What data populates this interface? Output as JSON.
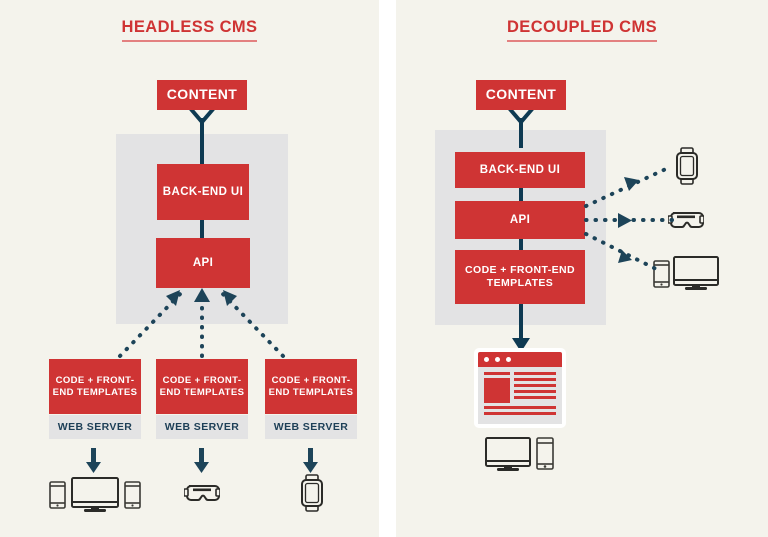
{
  "theme": {
    "background": "#f4f3ec",
    "accent_red": "#cf3434",
    "navy": "#0e3a52",
    "gray_panel": "#e3e3e4",
    "page_white": "#ffffff"
  },
  "panels": [
    {
      "id": "headless",
      "title": "HEADLESS CMS",
      "content_box": "CONTENT",
      "backend_box": "BACK-END UI",
      "api_box": "API",
      "server_columns": [
        {
          "code_label": "CODE + FRONT-END TEMPLATES",
          "server_label": "WEB SERVER",
          "device_group": "phone-monitor-tablet"
        },
        {
          "code_label": "CODE + FRONT-END TEMPLATES",
          "server_label": "WEB SERVER",
          "device_group": "vr-headset"
        },
        {
          "code_label": "CODE + FRONT-END TEMPLATES",
          "server_label": "WEB SERVER",
          "device_group": "smartwatch"
        }
      ]
    },
    {
      "id": "decoupled",
      "title": "DECOUPLED CMS",
      "content_box": "CONTENT",
      "backend_box": "BACK-END UI",
      "api_box": "API",
      "code_box": "CODE + FRONT-END TEMPLATES",
      "api_consumers": [
        "smartwatch",
        "vr-headset",
        "tablet-monitor"
      ],
      "output_devices": [
        "monitor",
        "phone"
      ]
    }
  ],
  "chart_data": {
    "type": "diagram",
    "title": "Headless CMS vs Decoupled CMS",
    "nodes": [
      {
        "panel": "headless",
        "label": "CONTENT",
        "kind": "red-box"
      },
      {
        "panel": "headless",
        "label": "BACK-END UI",
        "kind": "red-box",
        "inside": "cms-gray-region"
      },
      {
        "panel": "headless",
        "label": "API",
        "kind": "red-box",
        "inside": "cms-gray-region"
      },
      {
        "panel": "headless",
        "label": "CODE + FRONT-END TEMPLATES",
        "kind": "red-box",
        "instances": 3
      },
      {
        "panel": "headless",
        "label": "WEB SERVER",
        "kind": "gray-box",
        "instances": 3
      },
      {
        "panel": "decoupled",
        "label": "CONTENT",
        "kind": "red-box"
      },
      {
        "panel": "decoupled",
        "label": "BACK-END UI",
        "kind": "red-box",
        "inside": "cms-gray-region"
      },
      {
        "panel": "decoupled",
        "label": "API",
        "kind": "red-box",
        "inside": "cms-gray-region"
      },
      {
        "panel": "decoupled",
        "label": "CODE + FRONT-END TEMPLATES",
        "kind": "red-box",
        "inside": "cms-gray-region"
      }
    ],
    "edges": [
      {
        "panel": "headless",
        "from": "CONTENT",
        "to": "BACK-END UI",
        "style": "solid"
      },
      {
        "panel": "headless",
        "from": "BACK-END UI",
        "to": "API",
        "style": "solid"
      },
      {
        "panel": "headless",
        "from": "CODE + FRONT-END TEMPLATES",
        "to": "API",
        "style": "dotted",
        "instances": 3
      },
      {
        "panel": "headless",
        "from": "WEB SERVER",
        "to": "devices",
        "style": "solid-arrow",
        "instances": 3
      },
      {
        "panel": "decoupled",
        "from": "CONTENT",
        "to": "BACK-END UI",
        "style": "solid"
      },
      {
        "panel": "decoupled",
        "from": "BACK-END UI",
        "to": "API",
        "style": "solid"
      },
      {
        "panel": "decoupled",
        "from": "API",
        "to": "CODE + FRONT-END TEMPLATES",
        "style": "solid"
      },
      {
        "panel": "decoupled",
        "from": "devices",
        "to": "API",
        "style": "dotted",
        "instances": 3
      },
      {
        "panel": "decoupled",
        "from": "CODE + FRONT-END TEMPLATES",
        "to": "website",
        "style": "solid-arrow"
      }
    ]
  }
}
